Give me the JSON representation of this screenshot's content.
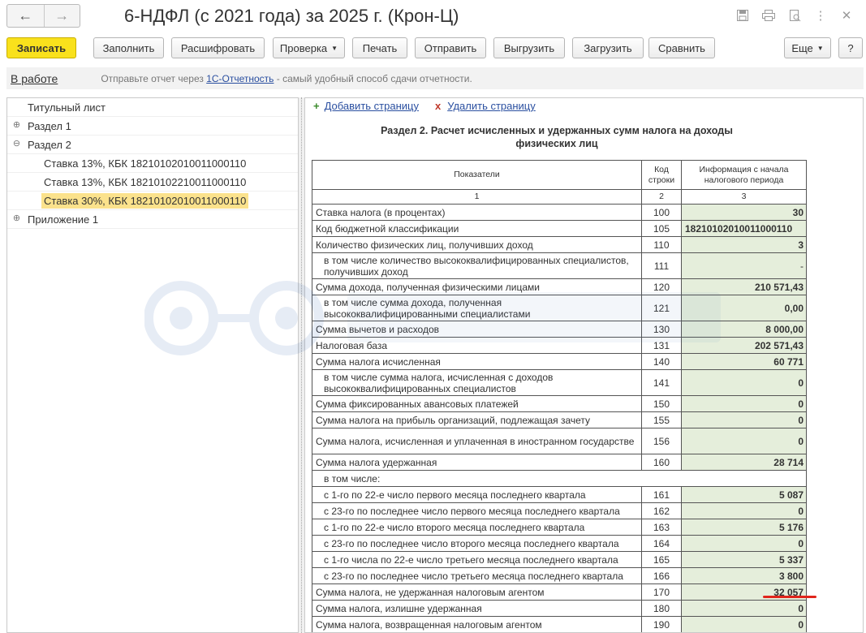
{
  "window": {
    "title": "6-НДФЛ (с 2021 года) за 2025 г. (Крон-Ц)"
  },
  "toolbar": {
    "save": "Записать",
    "fill": "Заполнить",
    "decode": "Расшифровать",
    "check": "Проверка",
    "print": "Печать",
    "send": "Отправить",
    "upload": "Выгрузить",
    "load": "Загрузить",
    "compare": "Сравнить",
    "more": "Еще",
    "help": "?"
  },
  "infobar": {
    "status": "В работе",
    "text_before": "Отправьте отчет через ",
    "link": "1С-Отчетность",
    "text_after": " - самый удобный способ сдачи отчетности."
  },
  "tree": {
    "items": [
      {
        "label": "Титульный лист"
      },
      {
        "label": "Раздел 1"
      },
      {
        "label": "Раздел 2"
      },
      {
        "label": "Ставка 13%, КБК 18210102010011000110"
      },
      {
        "label": "Ставка 13%, КБК 18210102210011000110"
      },
      {
        "label": "Ставка 30%, КБК 18210102010011000110"
      },
      {
        "label": "Приложение 1"
      }
    ]
  },
  "doc": {
    "add_page": "Добавить страницу",
    "delete_page": "Удалить страницу",
    "section_title_line1": "Раздел 2. Расчет исчисленных и удержанных сумм налога на доходы",
    "section_title_line2": "физических лиц",
    "col_indicators": "Показатели",
    "col_code_line1": "Код",
    "col_code_line2": "строки",
    "col_info_line1": "Информация с начала",
    "col_info_line2": "налогового периода",
    "col_num1": "1",
    "col_num2": "2",
    "col_num3": "3",
    "rows": [
      {
        "name": "Ставка налога (в процентах)",
        "code": "100",
        "value": "30"
      },
      {
        "name": "Код бюджетной классификации",
        "code": "105",
        "value": "18210102010011000110"
      },
      {
        "name": "Количество физических лиц, получивших доход",
        "code": "110",
        "value": "3"
      },
      {
        "name": "в том числе количество высококвалифицированных специалистов, получивших доход",
        "code": "111",
        "value": "-"
      },
      {
        "name": "Сумма дохода, полученная физическими лицами",
        "code": "120",
        "value": "210 571,43"
      },
      {
        "name": "в том числе сумма дохода, полученная высококвалифицированными специалистами",
        "code": "121",
        "value": "0,00"
      },
      {
        "name": "Сумма вычетов и расходов",
        "code": "130",
        "value": "8 000,00"
      },
      {
        "name": "Налоговая база",
        "code": "131",
        "value": "202 571,43"
      },
      {
        "name": "Сумма налога исчисленная",
        "code": "140",
        "value": "60 771"
      },
      {
        "name": "в том числе сумма налога, исчисленная с доходов высококвалифицированных специалистов",
        "code": "141",
        "value": "0"
      },
      {
        "name": "Сумма фиксированных авансовых платежей",
        "code": "150",
        "value": "0"
      },
      {
        "name": "Сумма налога на прибыль организаций, подлежащая зачету",
        "code": "155",
        "value": "0"
      },
      {
        "name": "Сумма налога, исчисленная и уплаченная в иностранном государстве",
        "code": "156",
        "value": "0"
      },
      {
        "name": "Сумма налога удержанная",
        "code": "160",
        "value": "28 714"
      },
      {
        "name": "в том числе:",
        "code": "",
        "value": ""
      },
      {
        "name": "с 1-го по 22-е число первого месяца последнего квартала",
        "code": "161",
        "value": "5 087"
      },
      {
        "name": "с 23-го по последнее число первого месяца последнего квартала",
        "code": "162",
        "value": "0"
      },
      {
        "name": "с 1-го по 22-е число второго месяца последнего квартала",
        "code": "163",
        "value": "5 176"
      },
      {
        "name": "с 23-го по последнее число второго месяца последнего квартала",
        "code": "164",
        "value": "0"
      },
      {
        "name": "с 1-го числа по 22-е число третьего месяца последнего квартала",
        "code": "165",
        "value": "5 337"
      },
      {
        "name": "с 23-го по последнее число третьего месяца последнего квартала",
        "code": "166",
        "value": "3 800"
      },
      {
        "name": "Сумма налога, не удержанная налоговым агентом",
        "code": "170",
        "value": "32 057"
      },
      {
        "name": "Сумма налога, излишне удержанная",
        "code": "180",
        "value": "0"
      },
      {
        "name": "Сумма налога, возвращенная налоговым агентом",
        "code": "190",
        "value": "0"
      }
    ]
  }
}
